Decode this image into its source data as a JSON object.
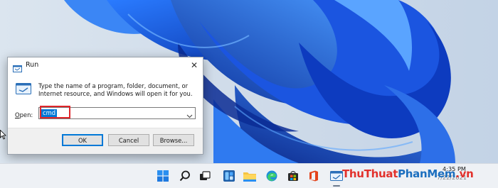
{
  "dialog": {
    "title": "Run",
    "description": "Type the name of a program, folder, document, or Internet resource, and Windows will open it for you.",
    "open_label_prefix": "",
    "open_label_accel": "O",
    "open_label_rest": "pen:",
    "input_value": "cmd",
    "ok_label": "OK",
    "cancel_label": "Cancel",
    "browse_label": "Browse...",
    "close_glyph": "✕"
  },
  "taskbar": {
    "time": "4:35 PM",
    "date": "7/22/2021",
    "icons": [
      "windows-start-icon",
      "search-icon",
      "task-view-icon",
      "widgets-icon",
      "file-explorer-icon",
      "edge-icon",
      "store-icon",
      "office-icon",
      "run-icon"
    ]
  },
  "watermark": {
    "part1": "ThuThuat",
    "part2": "PhanMem",
    "part3": ".vn"
  },
  "colors": {
    "accent": "#0078d7",
    "highlight": "#e0262a",
    "wallpaper_base": "#1a56d6"
  }
}
